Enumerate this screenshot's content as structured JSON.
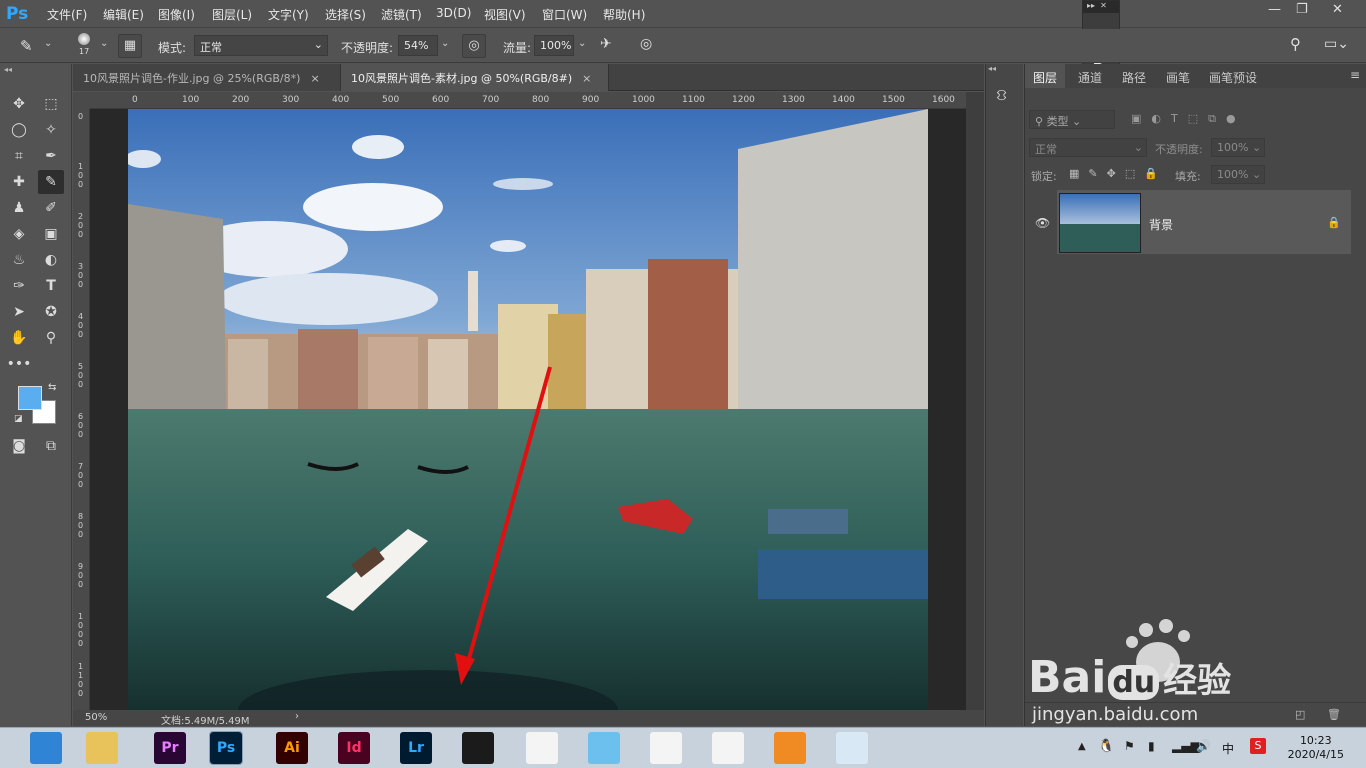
{
  "app": {
    "logo": "Ps"
  },
  "menu": [
    "文件(F)",
    "编辑(E)",
    "图像(I)",
    "图层(L)",
    "文字(Y)",
    "选择(S)",
    "滤镜(T)",
    "3D(D)",
    "视图(V)",
    "窗口(W)",
    "帮助(H)"
  ],
  "options": {
    "brush_size": "17",
    "mode_label": "模式:",
    "mode_value": "正常",
    "opacity_label": "不透明度:",
    "opacity_value": "54%",
    "flow_label": "流量:",
    "flow_value": "100%"
  },
  "tabs": [
    {
      "label": "10风景照片调色-作业.jpg @ 25%(RGB/8*)",
      "close": "×"
    },
    {
      "label": "10风景照片调色-素材.jpg @ 50%(RGB/8#)",
      "close": "×"
    }
  ],
  "ruler": {
    "top": [
      "0",
      "100",
      "200",
      "300",
      "400",
      "500",
      "600",
      "700",
      "800",
      "900",
      "1000",
      "1100",
      "1200",
      "1300",
      "1400",
      "1500",
      "1600"
    ],
    "left": [
      "0",
      "1\n0\n0",
      "2\n0\n0",
      "3\n0\n0",
      "4\n0\n0",
      "5\n0\n0",
      "6\n0\n0",
      "7\n0\n0",
      "8\n0\n0",
      "9\n0\n0",
      "1\n0\n0\n0",
      "1\n1\n0\n0"
    ]
  },
  "status": {
    "zoom": "50%",
    "doc": "文档:5.49M/5.49M",
    "arrow": "›"
  },
  "layers_panel": {
    "tabs": [
      "图层",
      "通道",
      "路径",
      "画笔",
      "画笔预设"
    ],
    "filter_label": "类型",
    "blend_mode": "正常",
    "opacity_label": "不透明度:",
    "opacity_value": "100%",
    "lock_label": "锁定:",
    "fill_label": "填充:",
    "fill_value": "100%",
    "layer_name": "背景"
  },
  "taskbar": {
    "apps": [
      {
        "name": "browser",
        "label": "",
        "bg": "#2f84d6"
      },
      {
        "name": "explorer",
        "label": "",
        "bg": "#e8c25a"
      },
      {
        "name": "premiere",
        "label": "Pr",
        "bg": "#2a0634",
        "fg": "#e77cff"
      },
      {
        "name": "photoshop",
        "label": "Ps",
        "bg": "#001e36",
        "fg": "#31a8ff"
      },
      {
        "name": "illustrator",
        "label": "Ai",
        "bg": "#330000",
        "fg": "#ff9a00"
      },
      {
        "name": "indesign",
        "label": "Id",
        "bg": "#49021f",
        "fg": "#ff3366"
      },
      {
        "name": "lightroom",
        "label": "Lr",
        "bg": "#001a30",
        "fg": "#31a8ff"
      },
      {
        "name": "video-editor",
        "label": "",
        "bg": "#1b1b1b"
      },
      {
        "name": "umbrella-app",
        "label": "",
        "bg": "#f4f4f4"
      },
      {
        "name": "cat-app",
        "label": "",
        "bg": "#6cc0ee"
      },
      {
        "name": "qq",
        "label": "",
        "bg": "#f4f4f4"
      },
      {
        "name": "chrome",
        "label": "",
        "bg": "#f4f4f4"
      },
      {
        "name": "fox-app",
        "label": "",
        "bg": "#f08a22"
      },
      {
        "name": "notebook-app",
        "label": "",
        "bg": "#d8e8f4"
      }
    ],
    "ime": "中",
    "time": "10:23",
    "date": "2020/4/15"
  },
  "watermark": {
    "brand": "Bai",
    "brand2": "du",
    "cn": "经验",
    "url": "jingyan.baidu.com"
  },
  "colors": {
    "accent": "#31a8ff",
    "foreground_swatch": "#5aaef0",
    "background_swatch": "#ffffff",
    "arrow": "#e01010"
  }
}
